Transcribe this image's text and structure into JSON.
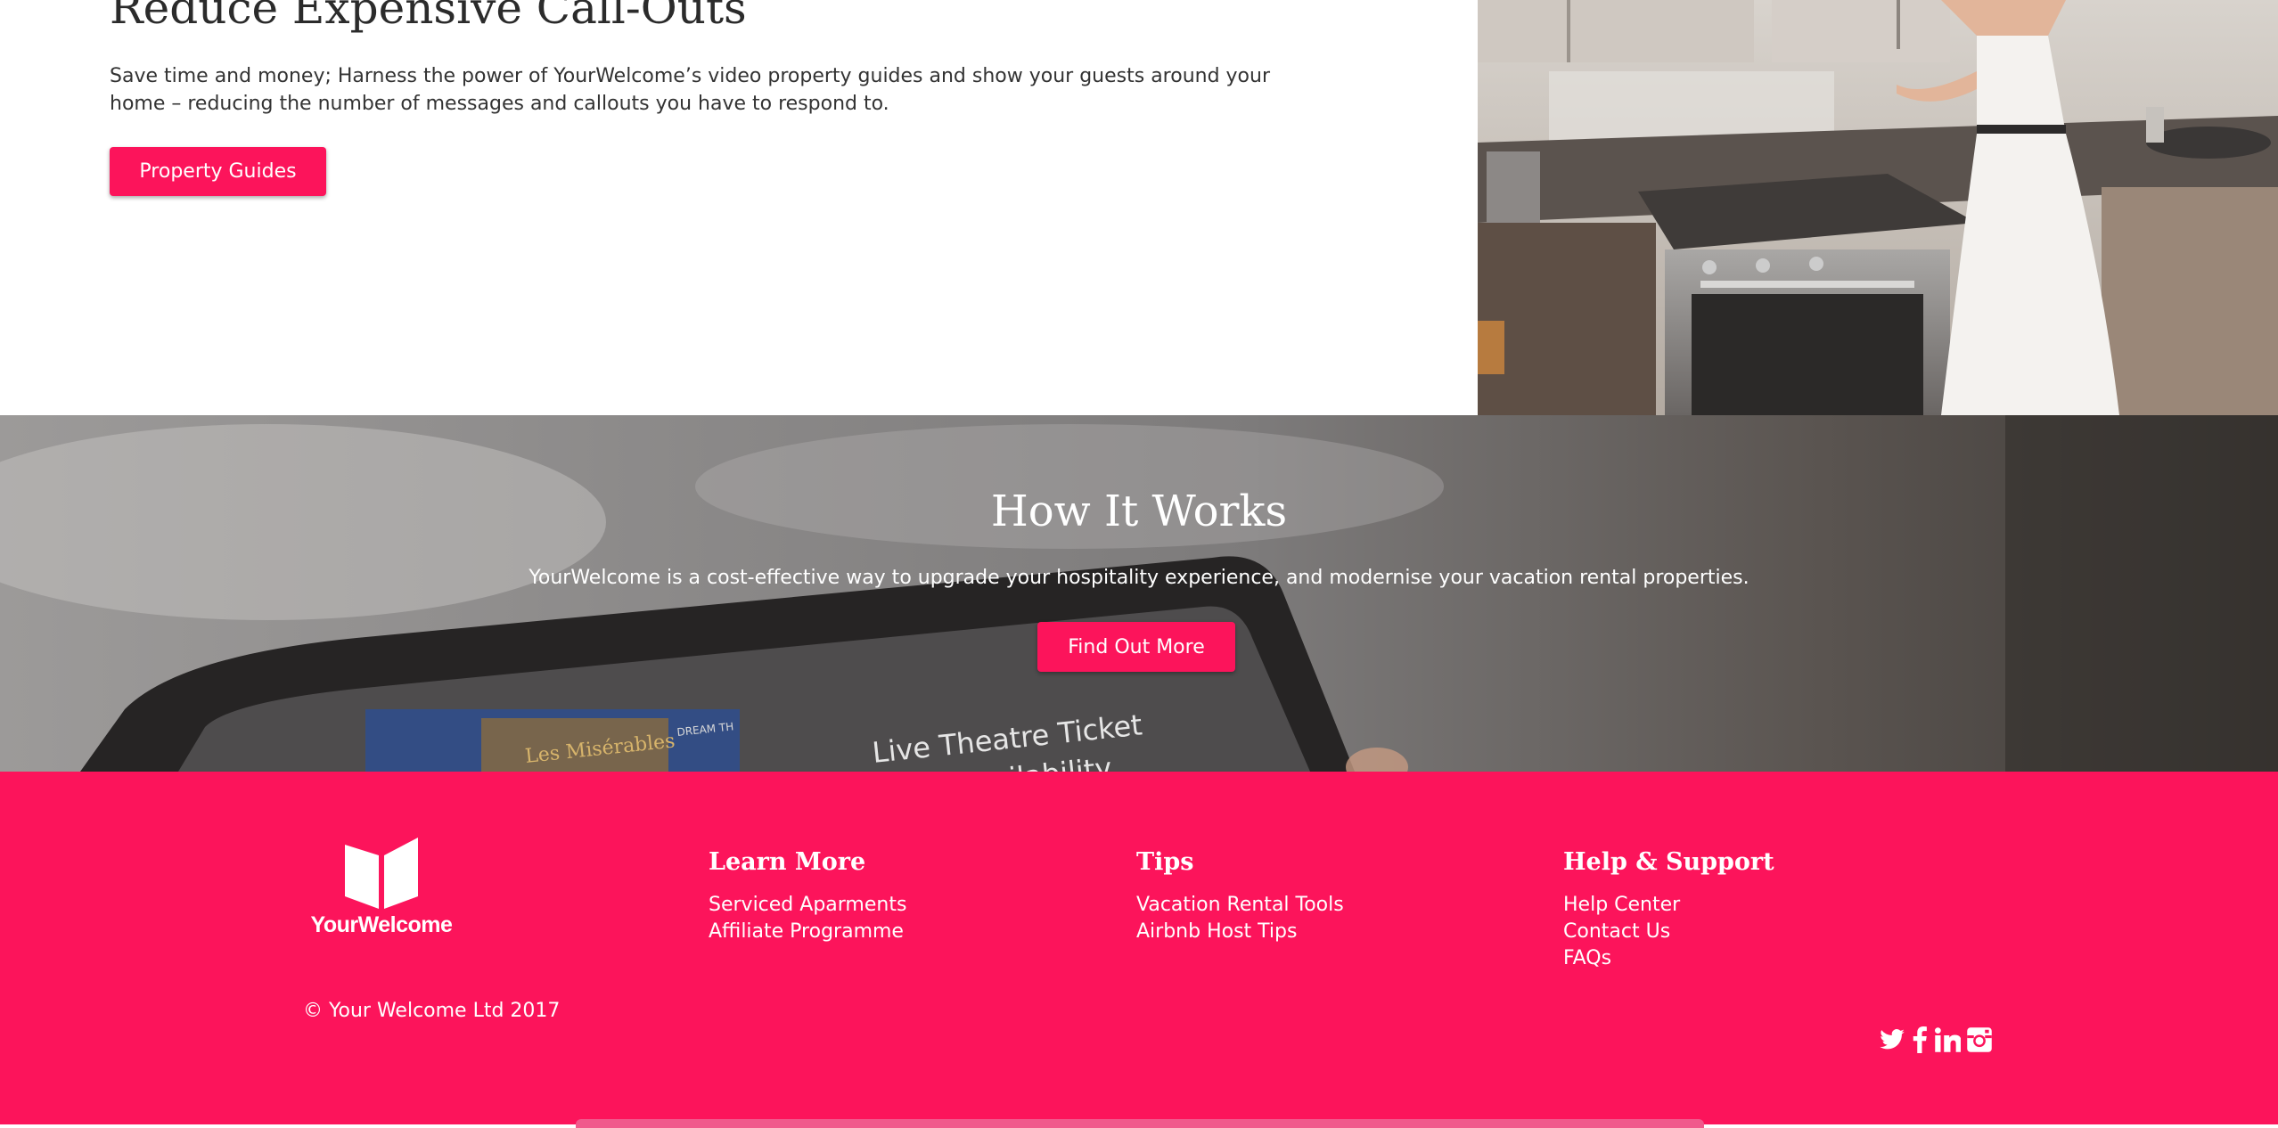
{
  "top_section": {
    "title": "Reduce Expensive Call-Outs",
    "description": "Save time and money; Harness the power of YourWelcome’s video property guides and show your guests around your home – reducing the number of messages and callouts you have to respond to.",
    "button_label": "Property Guides"
  },
  "how_it_works": {
    "title": "How It Works",
    "description": "YourWelcome is a cost-effective way to upgrade your hospitality experience, and modernise your vacation rental properties.",
    "button_label": "Find Out More",
    "background_text_1": "Live Theatre Ticket",
    "background_text_2": "and Availability.",
    "background_text_3": "Les Misérables",
    "background_text_4": "DREAM TH"
  },
  "footer": {
    "logo_text": "YourWelcome",
    "copyright": "© Your Welcome Ltd 2017",
    "columns": [
      {
        "title": "Learn More",
        "links": [
          "Serviced Aparments",
          "Affiliate Programme"
        ]
      },
      {
        "title": "Tips",
        "links": [
          "Vacation Rental Tools",
          "Airbnb Host Tips"
        ]
      },
      {
        "title": "Help & Support",
        "links": [
          "Help Center",
          "Contact Us",
          "FAQs"
        ]
      }
    ],
    "social_icons": [
      "twitter-icon",
      "facebook-icon",
      "linkedin-icon",
      "instagram-icon"
    ]
  },
  "colors": {
    "accent": "#fc145b",
    "text_dark": "#2b2b2b",
    "white": "#ffffff"
  }
}
